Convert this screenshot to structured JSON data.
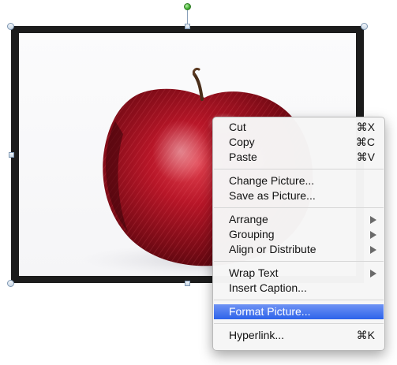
{
  "context_menu": {
    "groups": [
      [
        {
          "label": "Cut",
          "shortcut": "⌘X"
        },
        {
          "label": "Copy",
          "shortcut": "⌘C"
        },
        {
          "label": "Paste",
          "shortcut": "⌘V"
        }
      ],
      [
        {
          "label": "Change Picture..."
        },
        {
          "label": "Save as Picture..."
        }
      ],
      [
        {
          "label": "Arrange",
          "submenu": true
        },
        {
          "label": "Grouping",
          "submenu": true
        },
        {
          "label": "Align or Distribute",
          "submenu": true
        }
      ],
      [
        {
          "label": "Wrap Text",
          "submenu": true
        },
        {
          "label": "Insert Caption..."
        }
      ],
      [
        {
          "label": "Format Picture...",
          "selected": true
        }
      ],
      [
        {
          "label": "Hyperlink...",
          "shortcut": "⌘K"
        }
      ]
    ]
  },
  "colors": {
    "frame": "#1c1c1c",
    "selection_highlight": "#2d63ea",
    "rotate_handle": "#3fae2f",
    "apple_red": "#b01422"
  },
  "icons": {
    "submenu": "submenu-arrow-icon",
    "rotate": "rotate-handle-icon"
  }
}
